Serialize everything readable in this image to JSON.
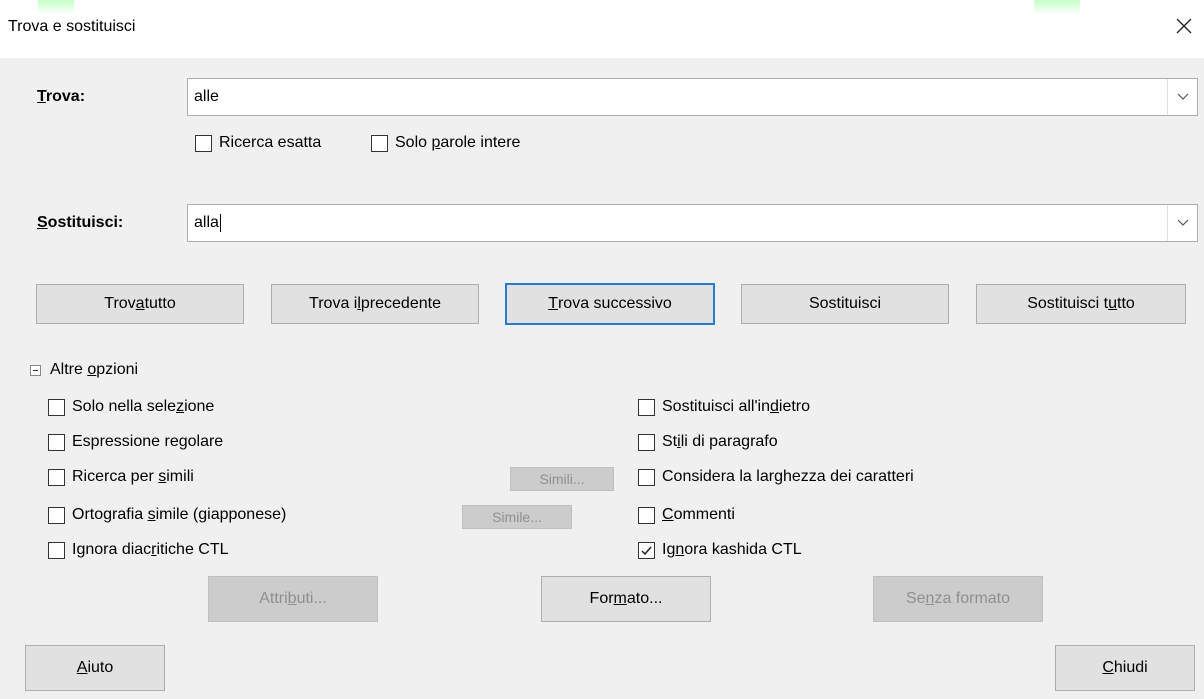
{
  "dialog": {
    "title": "Trova e sostituisci"
  },
  "find": {
    "label_first": "T",
    "label_rest": "rova:",
    "value": "alle",
    "options": {
      "exact": "Ricerca esatta",
      "whole_pre": "Solo ",
      "whole_u": "p",
      "whole_post": "arole intere"
    }
  },
  "replace": {
    "label_first": "S",
    "label_rest": "ostituisci:",
    "value": "alla"
  },
  "actions": {
    "find_all_pre": "Trov",
    "find_all_u": "a",
    "find_all_post": " tutto",
    "find_prev_pre": "Trova i",
    "find_prev_u": "l",
    "find_prev_post": " precedente",
    "find_next_u": "T",
    "find_next_post": "rova successivo",
    "replace": "Sostituisci",
    "replace_all_pre": "Sostituisci t",
    "replace_all_u": "u",
    "replace_all_post": "tto"
  },
  "more": {
    "label_pre": "Altre ",
    "label_u": "o",
    "label_post": "pzioni",
    "left": {
      "selection_pre": "Solo nella sele",
      "selection_u": "z",
      "selection_post": "ione",
      "regex_pre": "Espressione re",
      "regex_u": "g",
      "regex_post": "olare",
      "similar_pre": "Ricerca per ",
      "similar_u": "s",
      "similar_post": "imili",
      "similar_btn": "Simili...",
      "japanese_pre": "Ortografia ",
      "japanese_u": "s",
      "japanese_post": "imile (giapponese)",
      "japanese_btn": "Simile...",
      "diacritics_pre": "Ignora diac",
      "diacritics_u": "r",
      "diacritics_post": "itiche CTL"
    },
    "right": {
      "backwards_pre": "Sostituisci all'in",
      "backwards_u": "d",
      "backwards_post": "ietro",
      "styles_pre": "St",
      "styles_u": "i",
      "styles_post": "li di paragrafo",
      "width_pre": "Considera la lar",
      "width_u": "g",
      "width_post": "hezza dei caratteri",
      "comments_u": "C",
      "comments_post": "ommenti",
      "kashida_pre": "Ig",
      "kashida_u": "n",
      "kashida_post": "ora kashida CTL"
    },
    "kashida_checked": true
  },
  "format": {
    "attributes_pre": "Attri",
    "attributes_u": "b",
    "attributes_post": "uti...",
    "format_pre": "For",
    "format_u": "m",
    "format_post": "ato...",
    "no_format_pre": "Se",
    "no_format_u": "n",
    "no_format_post": "za formato"
  },
  "footer": {
    "help_u": "A",
    "help_post": "iuto",
    "close_u": "C",
    "close_post": "hiudi"
  },
  "colors": {
    "focus_border": "#2a7bd0",
    "disabled_text": "#8f8f8f"
  }
}
